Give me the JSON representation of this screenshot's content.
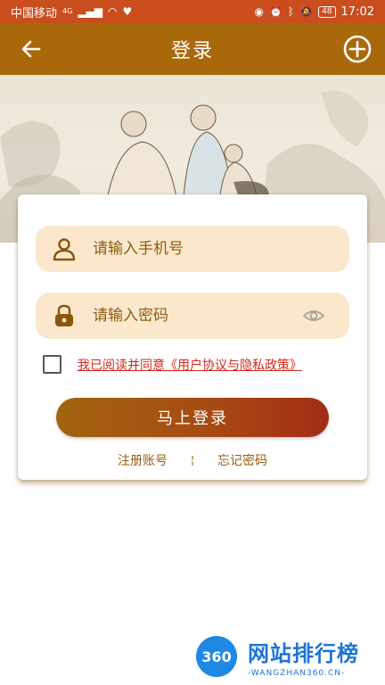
{
  "status_bar": {
    "carrier": "中国移动",
    "network": "4G",
    "battery": "48",
    "time": "17:02"
  },
  "header": {
    "title": "登录"
  },
  "form": {
    "phone_placeholder": "请输入手机号",
    "password_placeholder": "请输入密码",
    "agreement_text": "我已阅读并同意《用户协议与隐私政策》",
    "agreement_checked": false,
    "login_label": "马上登录",
    "register_label": "注册账号",
    "separator": "¦",
    "forgot_label": "忘记密码"
  },
  "watermark": {
    "logo_text": "360",
    "title": "网站排行榜",
    "subtitle": "-WANGZHAN360.CN-"
  },
  "colors": {
    "status_bar": "#c94d1d",
    "app_bar": "#a9690b",
    "field_bg": "#fbe8cc",
    "agreement_link": "#d2281b",
    "accent_text": "#9a5c12"
  }
}
